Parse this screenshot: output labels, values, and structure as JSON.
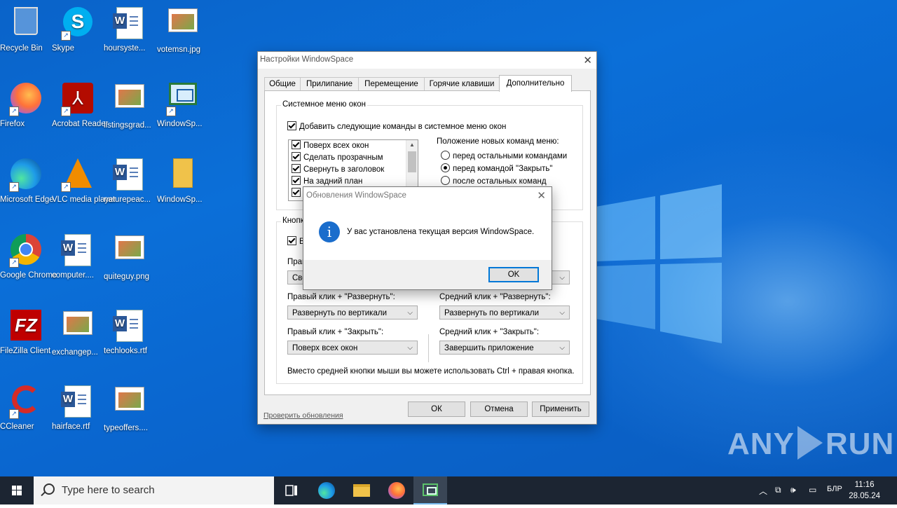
{
  "desktop": {
    "icons": [
      {
        "label": "Recycle Bin",
        "icon": "recycle-bin-icon"
      },
      {
        "label": "Skype",
        "icon": "skype-icon"
      },
      {
        "label": "hoursyste...",
        "icon": "word-document-icon"
      },
      {
        "label": "votemsn.jpg",
        "icon": "image-file-icon"
      },
      {
        "label": "Firefox",
        "icon": "firefox-icon"
      },
      {
        "label": "Acrobat Reader",
        "icon": "acrobat-icon"
      },
      {
        "label": "listingsgrad...",
        "icon": "image-file-icon"
      },
      {
        "label": "WindowSp...",
        "icon": "windowspace-icon"
      },
      {
        "label": "Microsoft Edge",
        "icon": "edge-icon"
      },
      {
        "label": "VLC media player",
        "icon": "vlc-icon"
      },
      {
        "label": "naturepeac...",
        "icon": "word-document-icon"
      },
      {
        "label": "WindowSp...",
        "icon": "folder-icon"
      },
      {
        "label": "Google Chrome",
        "icon": "chrome-icon"
      },
      {
        "label": "computer....",
        "icon": "word-document-icon"
      },
      {
        "label": "quiteguy.png",
        "icon": "image-file-icon"
      },
      {
        "label": "FileZilla Client",
        "icon": "filezilla-icon"
      },
      {
        "label": "exchangep...",
        "icon": "image-file-icon"
      },
      {
        "label": "techlooks.rtf",
        "icon": "word-document-icon"
      },
      {
        "label": "CCleaner",
        "icon": "ccleaner-icon"
      },
      {
        "label": "hairface.rtf",
        "icon": "word-document-icon"
      },
      {
        "label": "typeoffers....",
        "icon": "image-file-icon"
      }
    ]
  },
  "settings": {
    "title": "Настройки WindowSpace",
    "tabs": [
      "Общие",
      "Прилипание",
      "Перемещение",
      "Горячие клавиши",
      "Дополнительно"
    ],
    "active_tab": "Дополнительно",
    "sysmenu": {
      "group_label": "Системное меню окон",
      "add_commands_label": "Добавить следующие команды в системное меню окон",
      "commands": [
        "Поверх всех окон",
        "Сделать прозрачным",
        "Свернуть в заголовок",
        "На задний план"
      ],
      "position_label": "Положение новых команд меню:",
      "positions": [
        "перед остальными командами",
        "перед командой \"Закрыть\"",
        "после остальных команд"
      ],
      "selected_position": 1
    },
    "buttons_group": {
      "group_label": "Кнопк",
      "enable_label": "Ві",
      "row1_left_label": "Прав",
      "row1_left_value": "Све",
      "right_max_label": "Правый клик + \"Развернуть\":",
      "right_max_value": "Развернуть по вертикали",
      "middle_max_label": "Средний клик + \"Развернуть\":",
      "middle_max_value": "Развернуть по вертикали",
      "right_close_label": "Правый клик + \"Закрыть\":",
      "right_close_value": "Поверх всех окон",
      "middle_close_label": "Средний клик + \"Закрыть\":",
      "middle_close_value": "Завершить приложение",
      "hint": "Вместо средней кнопки мыши вы можете использовать Ctrl + правая кнопка."
    },
    "check_updates_link": "Проверить обновления",
    "ok": "ОК",
    "cancel": "Отмена",
    "apply": "Применить"
  },
  "popup": {
    "title": "Обновления WindowSpace",
    "message": "У вас установлена текущая версия WindowSpace.",
    "ok": "OK",
    "info_glyph": "i"
  },
  "watermark": {
    "left": "ANY",
    "right": "RUN"
  },
  "taskbar": {
    "search_placeholder": "Type here to search",
    "language": "БЛР",
    "time": "11:16",
    "date": "28.05.24"
  }
}
